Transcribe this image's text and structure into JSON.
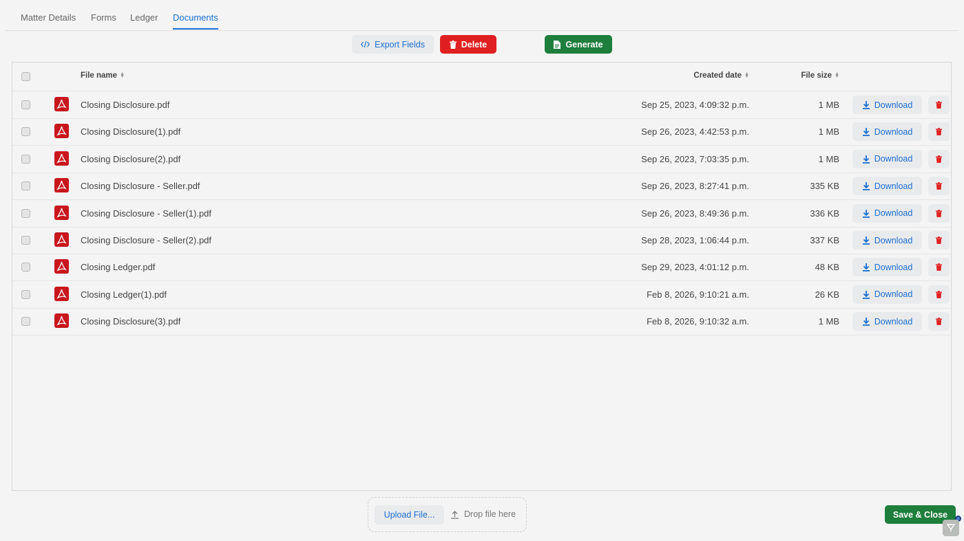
{
  "tabs": [
    {
      "label": "Matter Details"
    },
    {
      "label": "Forms"
    },
    {
      "label": "Ledger"
    },
    {
      "label": "Documents",
      "active": true
    }
  ],
  "toolbar": {
    "export_label": "Export Fields",
    "delete_label": "Delete",
    "generate_label": "Generate"
  },
  "table": {
    "columns": {
      "file_name": "File name",
      "created_date": "Created date",
      "file_size": "File size"
    },
    "download_label": "Download",
    "rows": [
      {
        "name": "Closing Disclosure.pdf",
        "date": "Sep 25, 2023, 4:09:32 p.m.",
        "size": "1 MB"
      },
      {
        "name": "Closing Disclosure(1).pdf",
        "date": "Sep 26, 2023, 4:42:53 p.m.",
        "size": "1 MB"
      },
      {
        "name": "Closing Disclosure(2).pdf",
        "date": "Sep 26, 2023, 7:03:35 p.m.",
        "size": "1 MB"
      },
      {
        "name": "Closing Disclosure - Seller.pdf",
        "date": "Sep 26, 2023, 8:27:41 p.m.",
        "size": "335 KB"
      },
      {
        "name": "Closing Disclosure - Seller(1).pdf",
        "date": "Sep 26, 2023, 8:49:36 p.m.",
        "size": "336 KB"
      },
      {
        "name": "Closing Disclosure - Seller(2).pdf",
        "date": "Sep 28, 2023, 1:06:44 p.m.",
        "size": "337 KB"
      },
      {
        "name": "Closing Ledger.pdf",
        "date": "Sep 29, 2023, 4:01:12 p.m.",
        "size": "48 KB"
      },
      {
        "name": "Closing Ledger(1).pdf",
        "date": "Feb 8, 2026, 9:10:21 a.m.",
        "size": "26 KB"
      },
      {
        "name": "Closing Disclosure(3).pdf",
        "date": "Feb 8, 2026, 9:10:32 a.m.",
        "size": "1 MB"
      }
    ]
  },
  "upload": {
    "button_label": "Upload File...",
    "drop_label": "Drop file here"
  },
  "footer": {
    "save_label": "Save & Close"
  },
  "colors": {
    "accent": "#1a6fd1",
    "danger": "#e02020",
    "success": "#1e7e3c"
  }
}
